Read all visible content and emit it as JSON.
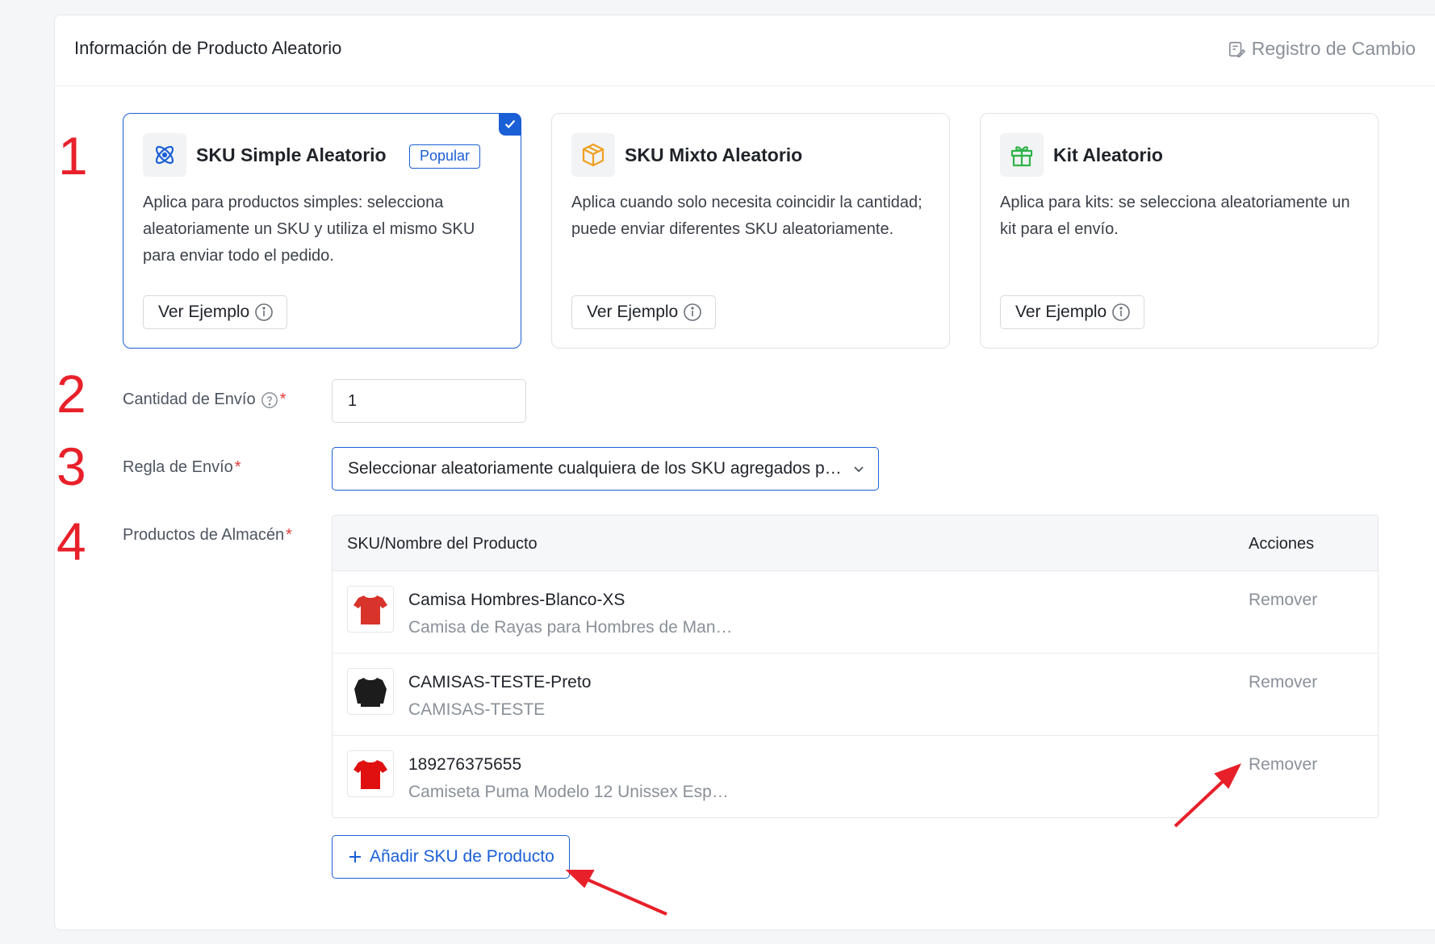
{
  "header": {
    "title": "Información de Producto Aleatorio",
    "changelog_label": "Registro de Cambio"
  },
  "steps": [
    "1",
    "2",
    "3",
    "4"
  ],
  "cards": [
    {
      "title": "SKU Simple Aleatorio",
      "badge": "Popular",
      "description": "Aplica para productos simples: selecciona aleatoriamente un SKU y utiliza el mismo SKU para enviar todo el pedido.",
      "button_label": "Ver Ejemplo",
      "selected": true,
      "icon": "atom-icon"
    },
    {
      "title": "SKU Mixto Aleatorio",
      "description": "Aplica cuando solo necesita coincidir la cantidad; puede enviar diferentes SKU aleatoriamente.",
      "button_label": "Ver Ejemplo",
      "selected": false,
      "icon": "box-icon"
    },
    {
      "title": "Kit Aleatorio",
      "description": "Aplica para kits: se selecciona aleatoriamente un kit para el envío.",
      "button_label": "Ver Ejemplo",
      "selected": false,
      "icon": "gift-icon"
    }
  ],
  "form": {
    "quantity_label": "Cantidad de Envío",
    "quantity_value": "1",
    "rule_label": "Regla de Envío",
    "rule_value": "Seleccionar aleatoriamente cualquiera de los SKU agregados para enviar",
    "products_label": "Productos de Almacén",
    "required_mark": "*"
  },
  "table": {
    "columns": [
      "SKU/Nombre del Producto",
      "Acciones"
    ],
    "rows": [
      {
        "name": "Camisa Hombres-Blanco-XS",
        "subtitle": "Camisa de Rayas para Hombres de Man…",
        "action": "Remover",
        "thumb_color": "#d8342c"
      },
      {
        "name": "CAMISAS-TESTE-Preto",
        "subtitle": "CAMISAS-TESTE",
        "action": "Remover",
        "thumb_color": "#1c1c1c"
      },
      {
        "name": "189276375655",
        "subtitle": "Camiseta Puma Modelo 12 Unissex Esp…",
        "action": "Remover",
        "thumb_color": "#e01010"
      }
    ]
  },
  "add_button_label": "Añadir SKU de Producto",
  "colors": {
    "accent": "#1a5fd6",
    "annotation": "#e8202a"
  }
}
